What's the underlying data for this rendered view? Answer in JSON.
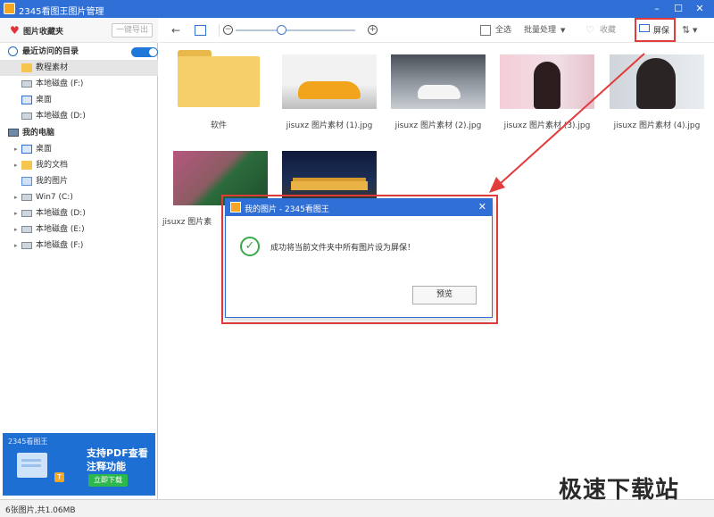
{
  "window": {
    "title": "2345看图王图片管理",
    "minimize": "–",
    "maximize": "☐",
    "close": "✕"
  },
  "sidebar": {
    "favorites_label": "图片收藏夹",
    "export_label": "一键导出",
    "recent_label": "最近访问的目录",
    "recent_items": [
      {
        "label": "教程素材",
        "icon": "folder-icon"
      },
      {
        "label": "本地磁盘 (F:)",
        "icon": "drive-icon"
      },
      {
        "label": "桌面",
        "icon": "desktop-icon"
      },
      {
        "label": "本地磁盘 (D:)",
        "icon": "drive-icon"
      }
    ],
    "computer_label": "我的电脑",
    "computer_items": [
      {
        "label": "桌面",
        "icon": "desktop-icon"
      },
      {
        "label": "我的文档",
        "icon": "folder-icon"
      },
      {
        "label": "我的图片",
        "icon": "pictures-icon"
      },
      {
        "label": "Win7 (C:)",
        "icon": "windows-drive-icon"
      },
      {
        "label": "本地磁盘 (D:)",
        "icon": "drive-icon"
      },
      {
        "label": "本地磁盘 (E:)",
        "icon": "drive-icon"
      },
      {
        "label": "本地磁盘 (F:)",
        "icon": "drive-icon"
      }
    ],
    "ad": {
      "brand": "2345看图王",
      "line1": "支持PDF查看",
      "line2": "注释功能",
      "button": "立即下载"
    }
  },
  "toolbar": {
    "select_all": "全选",
    "batch": "批量处理",
    "favorite": "收藏",
    "screensaver": "屏保"
  },
  "files": [
    {
      "name": "软件",
      "type": "folder"
    },
    {
      "name": "jisuxz 图片素材 (1).jpg",
      "type": "image"
    },
    {
      "name": "jisuxz 图片素材 (2).jpg",
      "type": "image"
    },
    {
      "name": "jisuxz 图片素材 (3).jpg",
      "type": "image"
    },
    {
      "name": "jisuxz 图片素材 (4).jpg",
      "type": "image"
    },
    {
      "name": "jisuxz 图片素",
      "type": "image"
    },
    {
      "name": "",
      "type": "image"
    }
  ],
  "dialog": {
    "title": "我的图片 - 2345看图王",
    "message": "成功将当前文件夹中所有图片设为屏保！",
    "preview_button": "预览"
  },
  "status": {
    "text": "6张图片,共1.06MB"
  },
  "watermark": "极速下载站",
  "colors": {
    "accent": "#2f6fd6",
    "highlight": "#e23b3b",
    "success": "#3aa84d"
  }
}
